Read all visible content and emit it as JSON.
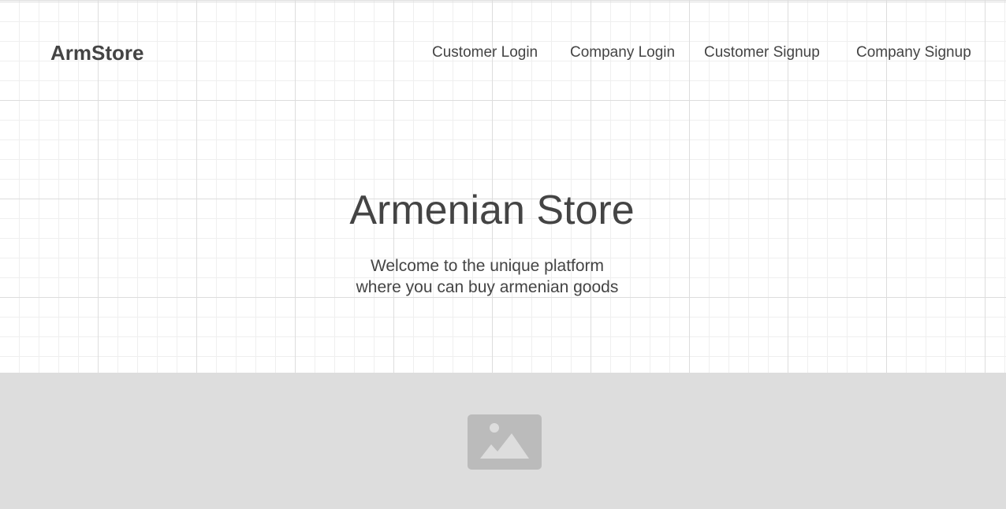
{
  "header": {
    "logo": "ArmStore",
    "nav": [
      {
        "label": "Customer Login"
      },
      {
        "label": "Company Login"
      },
      {
        "label": "Customer Signup"
      },
      {
        "label": "Company Signup"
      }
    ]
  },
  "hero": {
    "title": "Armenian Store",
    "subtitle_line1": "Welcome to the unique platform",
    "subtitle_line2": "where you can buy armenian goods"
  },
  "banner": {
    "icon": "image-placeholder-icon"
  },
  "colors": {
    "text": "#444444",
    "grid_major": "#dddddd",
    "grid_minor": "#efefef",
    "banner_bg": "#dddddd",
    "icon": "#bbbbbb"
  }
}
